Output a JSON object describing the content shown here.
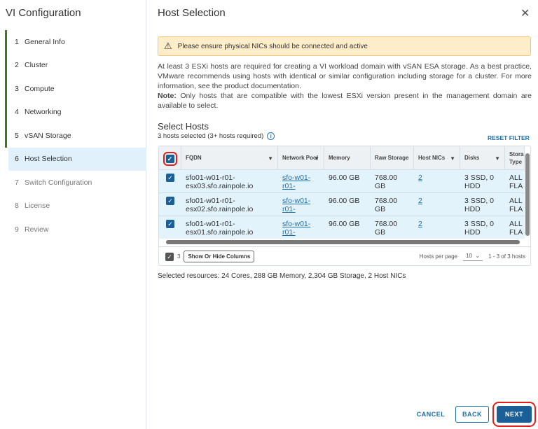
{
  "sidebar": {
    "title": "VI Configuration",
    "steps": [
      {
        "num": "1",
        "label": "General Info"
      },
      {
        "num": "2",
        "label": "Cluster"
      },
      {
        "num": "3",
        "label": "Compute"
      },
      {
        "num": "4",
        "label": "Networking"
      },
      {
        "num": "5",
        "label": "vSAN Storage"
      },
      {
        "num": "6",
        "label": "Host Selection"
      },
      {
        "num": "7",
        "label": "Switch Configuration"
      },
      {
        "num": "8",
        "label": "License"
      },
      {
        "num": "9",
        "label": "Review"
      }
    ]
  },
  "main": {
    "title": "Host Selection",
    "close": "✕",
    "alert": "Please ensure physical NICs should be connected and active",
    "para": "At least 3 ESXi hosts are required for creating a VI workload domain with vSAN ESA storage. As a best practice, VMware recommends using hosts with identical or similar configuration including storage for a cluster. For more information, see the product documentation.",
    "note_label": "Note:",
    "note": " Only hosts that are compatible with the lowest ESXi version present in the management domain are available to select.",
    "select_title": "Select Hosts",
    "select_sub": "3 hosts selected (3+ hosts required)",
    "reset": "RESET FILTER",
    "columns": [
      "FQDN",
      "Network Pool",
      "Memory",
      "Raw Storage",
      "Host NICs",
      "Disks",
      "Storage Type"
    ],
    "rows": [
      {
        "fqdn": "sfo01-w01-r01-esx03.sfo.rainpole.io",
        "pool": "sfo-w01-r01-",
        "memory": "96.00 GB",
        "storage": "768.00 GB",
        "nics": "2",
        "disks": "3 SSD, 0 HDD",
        "type": "ALL FLA"
      },
      {
        "fqdn": "sfo01-w01-r01-esx02.sfo.rainpole.io",
        "pool": "sfo-w01-r01-",
        "memory": "96.00 GB",
        "storage": "768.00 GB",
        "nics": "2",
        "disks": "3 SSD, 0 HDD",
        "type": "ALL FLA"
      },
      {
        "fqdn": "sfo01-w01-r01-esx01.sfo.rainpole.io",
        "pool": "sfo-w01-r01-",
        "memory": "96.00 GB",
        "storage": "768.00 GB",
        "nics": "2",
        "disks": "3 SSD, 0 HDD",
        "type": "ALL FLA"
      }
    ],
    "footer": {
      "count": "3",
      "show_hide": "Show Or Hide Columns",
      "per_page_label": "Hosts per page",
      "per_page": "10",
      "range": "1 - 3 of 3 hosts"
    },
    "summary": "Selected resources: 24 Cores, 288 GB Memory, 2,304 GB Storage, 2 Host NICs",
    "buttons": {
      "cancel": "CANCEL",
      "back": "BACK",
      "next": "NEXT"
    }
  }
}
